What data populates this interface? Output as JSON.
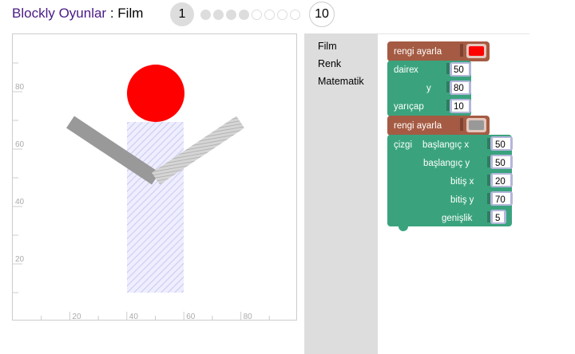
{
  "header": {
    "app_name": "Blockly Oyunlar",
    "separator": " : ",
    "game_name": "Film",
    "current_level": "1",
    "last_level": "10",
    "level_dots": [
      "filled",
      "filled",
      "filled",
      "filled",
      "empty",
      "empty",
      "empty",
      "empty"
    ]
  },
  "toolbox": {
    "categories": [
      "Film",
      "Renk",
      "Matematik"
    ]
  },
  "canvas": {
    "y_axis_labels": [
      "80",
      "60",
      "40",
      "20"
    ],
    "x_axis_labels": [
      "20",
      "40",
      "60",
      "80"
    ],
    "colors": {
      "head": "#ff0000",
      "arms": "#999999",
      "body_hatch": "#ccccff"
    }
  },
  "blocks": {
    "set_color_1": {
      "label": "rengi ayarla",
      "color": "#ff0000"
    },
    "circle": {
      "label": "daire",
      "x_label": "x",
      "x_value": "50",
      "y_label": "y",
      "y_value": "80",
      "radius_label": "yarıçap",
      "radius_value": "10"
    },
    "set_color_2": {
      "label": "rengi ayarla",
      "color": "#999999"
    },
    "line": {
      "label": "çizgi",
      "x1_label": "başlangıç x",
      "x1_value": "50",
      "y1_label": "başlangıç y",
      "y1_value": "50",
      "x2_label": "bitiş x",
      "x2_value": "20",
      "y2_label": "bitiş y",
      "y2_value": "70",
      "width_label": "genişlik",
      "width_value": "5"
    },
    "colors": {
      "set_color_block": "#a55b43",
      "movie_block": "#3aa37e",
      "math_slot": "#b4b6da"
    }
  }
}
